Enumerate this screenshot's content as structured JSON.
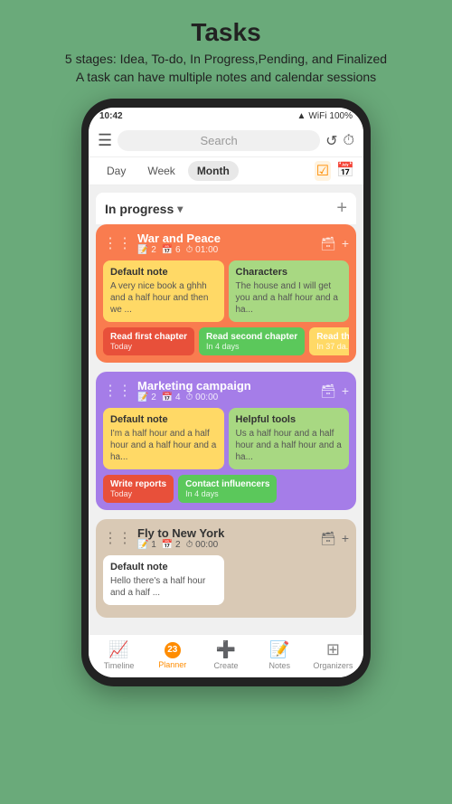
{
  "header": {
    "title": "Tasks",
    "subtitle_line1": "5 stages: Idea, To-do, In Progress,Pending, and Finalized",
    "subtitle_line2": "A task can have multiple notes and calendar sessions"
  },
  "status_bar": {
    "time": "10:42",
    "battery": "100%",
    "signal": "▲▼",
    "wifi": "WiFi"
  },
  "top_bar": {
    "search_placeholder": "Search",
    "refresh_icon": "↺",
    "timer_icon": "⏱"
  },
  "view_tabs": {
    "tabs": [
      {
        "label": "Day",
        "active": false
      },
      {
        "label": "Week",
        "active": false
      },
      {
        "label": "Month",
        "active": true
      }
    ],
    "icon_check": "☑",
    "icon_calendar": "📅"
  },
  "section": {
    "title": "In progress",
    "add_label": "+"
  },
  "tasks": [
    {
      "id": "war-and-peace",
      "title": "War and Peace",
      "meta_notes": "2",
      "meta_sessions": "6",
      "meta_time": "01:00",
      "color": "orange",
      "notes": [
        {
          "title": "Default note",
          "text": "A very nice book a ghhh and a half hour and then we ...",
          "color": "yellow"
        },
        {
          "title": "Characters",
          "text": "The house and I will get you and a half hour and a ha...",
          "color": "green"
        }
      ],
      "sessions": [
        {
          "title": "Read first chapter",
          "sub": "Today",
          "color": "red"
        },
        {
          "title": "Read second chapter",
          "sub": "In 4 days",
          "color": "green"
        },
        {
          "title": "Read th...",
          "sub": "In 37 da...",
          "color": "yellow"
        }
      ]
    },
    {
      "id": "marketing-campaign",
      "title": "Marketing campaign",
      "meta_notes": "2",
      "meta_sessions": "4",
      "meta_time": "00:00",
      "color": "purple",
      "notes": [
        {
          "title": "Default note",
          "text": "I'm a half hour and a half hour and a half hour and a ha...",
          "color": "yellow"
        },
        {
          "title": "Helpful tools",
          "text": "Us a half hour and a half hour and a half hour and a ha...",
          "color": "green"
        }
      ],
      "sessions": [
        {
          "title": "Write reports",
          "sub": "Today",
          "color": "red"
        },
        {
          "title": "Contact influencers",
          "sub": "In 4 days",
          "color": "green"
        }
      ]
    },
    {
      "id": "fly-to-new-york",
      "title": "Fly to New York",
      "meta_notes": "1",
      "meta_sessions": "2",
      "meta_time": "00:00",
      "color": "beige",
      "notes": [
        {
          "title": "Default note",
          "text": "Hello there's a half hour and a half ...",
          "color": "white"
        }
      ],
      "sessions": []
    }
  ],
  "bottom_nav": [
    {
      "label": "Timeline",
      "icon": "📈",
      "active": false
    },
    {
      "label": "Planner",
      "icon": "📅",
      "active": true,
      "badge": "23"
    },
    {
      "label": "Create",
      "icon": "➕",
      "active": false
    },
    {
      "label": "Notes",
      "icon": "📝",
      "active": false
    },
    {
      "label": "Organizers",
      "icon": "⊞",
      "active": false
    }
  ]
}
